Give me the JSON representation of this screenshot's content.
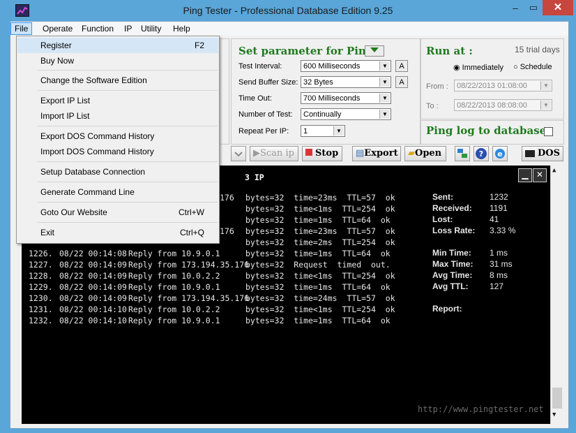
{
  "window": {
    "title": "Ping Tester - Professional Database Edition  9.25",
    "minimize": "–",
    "maximize": "▭",
    "close": "✕"
  },
  "menubar": [
    "File",
    "Operate",
    "Function",
    "IP",
    "Utility",
    "Help"
  ],
  "file_menu": {
    "items": [
      {
        "label": "Register",
        "shortcut": "F2"
      },
      {
        "label": "Buy Now",
        "shortcut": ""
      },
      {
        "label": "Change the Software Edition",
        "shortcut": ""
      },
      {
        "label": "Export IP List",
        "shortcut": ""
      },
      {
        "label": "Import IP List",
        "shortcut": ""
      },
      {
        "label": "Export DOS Command History",
        "shortcut": ""
      },
      {
        "label": "Import DOS Command History",
        "shortcut": ""
      },
      {
        "label": "Setup Database Connection",
        "shortcut": ""
      },
      {
        "label": "Generate Command Line",
        "shortcut": ""
      },
      {
        "label": "Goto Our Website",
        "shortcut": "Ctrl+W"
      },
      {
        "label": "Exit",
        "shortcut": "Ctrl+Q"
      }
    ]
  },
  "params": {
    "header": "Set parameter for Ping:",
    "test_interval": {
      "label": "Test Interval:",
      "value": "600  Milliseconds"
    },
    "send_buffer": {
      "label": "Send Buffer Size:",
      "value": "32  Bytes"
    },
    "time_out": {
      "label": "Time Out:",
      "value": "700  Milliseconds"
    },
    "number_of_test": {
      "label": "Number of Test:",
      "value": "Continually"
    },
    "repeat_per_ip": {
      "label": "Repeat Per IP:",
      "value": "1"
    },
    "a_button": "A"
  },
  "run_at": {
    "header": "Run at :",
    "trial": "15 trial days",
    "immediately": "Immediately",
    "schedule": "Schedule",
    "from_label": "From :",
    "from_value": "08/22/2013 01:08:00",
    "to_label": "To :",
    "to_value": "08/22/2013 08:08:00"
  },
  "ping_log": {
    "label": "Ping log to database:"
  },
  "toolbar": {
    "scan_ip": "Scan ip",
    "stop": "Stop",
    "export": "Export",
    "open": "Open",
    "dos": "DOS"
  },
  "console": {
    "ip_header": "3  IP",
    "partial_rows": [
      {
        "reply": "176",
        "result": "bytes=32  time=23ms  TTL=57  ok"
      },
      {
        "reply": "",
        "result": "bytes=32  time<1ms  TTL=254  ok"
      },
      {
        "reply": "",
        "result": "bytes=32  time=1ms  TTL=64  ok"
      },
      {
        "reply": "176",
        "result": "bytes=32  time=23ms  TTL=57  ok"
      },
      {
        "reply": "",
        "result": "bytes=32  time=2ms  TTL=254  ok"
      }
    ],
    "rows": [
      {
        "num": "1226.",
        "date": "08/22 00:14:08",
        "reply": "Reply from 10.9.0.1",
        "result": "bytes=32  time=1ms  TTL=64  ok"
      },
      {
        "num": "1227.",
        "date": "08/22 00:14:09",
        "reply": "Reply from 173.194.35.176",
        "result": "bytes=32  Request  timed  out."
      },
      {
        "num": "1228.",
        "date": "08/22 00:14:09",
        "reply": "Reply from 10.0.2.2",
        "result": "bytes=32  time<1ms  TTL=254  ok"
      },
      {
        "num": "1229.",
        "date": "08/22 00:14:09",
        "reply": "Reply from 10.9.0.1",
        "result": "bytes=32  time=1ms  TTL=64  ok"
      },
      {
        "num": "1230.",
        "date": "08/22 00:14:09",
        "reply": "Reply from 173.194.35.176",
        "result": "bytes=32  time=24ms  TTL=57  ok"
      },
      {
        "num": "1231.",
        "date": "08/22 00:14:10",
        "reply": "Reply from 10.0.2.2",
        "result": "bytes=32  time<1ms  TTL=254  ok"
      },
      {
        "num": "1232.",
        "date": "08/22 00:14:10",
        "reply": "Reply from 10.9.0.1",
        "result": "bytes=32  time=1ms  TTL=64  ok"
      }
    ],
    "stats": [
      {
        "label": "Sent:",
        "value": "1232"
      },
      {
        "label": "Received:",
        "value": "1191"
      },
      {
        "label": "Lost:",
        "value": "41"
      },
      {
        "label": "Loss Rate:",
        "value": "3.33 %"
      },
      {
        "label": "Min Time:",
        "value": "1 ms"
      },
      {
        "label": "Max Time:",
        "value": "31 ms"
      },
      {
        "label": "Avg Time:",
        "value": "8 ms"
      },
      {
        "label": "Avg TTL:",
        "value": "127"
      },
      {
        "label": "Report:",
        "value": ""
      }
    ],
    "footer": "http://www.pingtester.net"
  }
}
